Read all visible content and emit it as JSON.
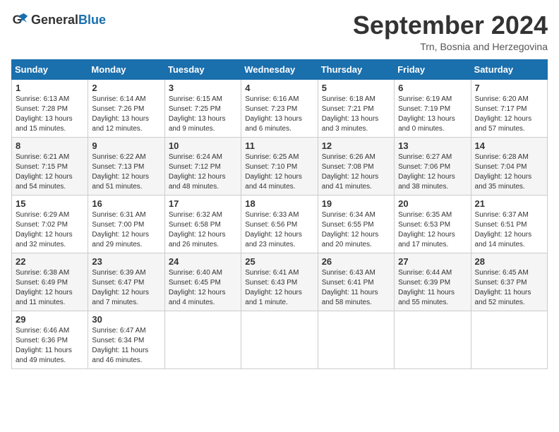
{
  "header": {
    "logo_general": "General",
    "logo_blue": "Blue",
    "month_title": "September 2024",
    "location": "Trn, Bosnia and Herzegovina"
  },
  "days_of_week": [
    "Sunday",
    "Monday",
    "Tuesday",
    "Wednesday",
    "Thursday",
    "Friday",
    "Saturday"
  ],
  "weeks": [
    [
      {
        "day": "1",
        "sunrise": "Sunrise: 6:13 AM",
        "sunset": "Sunset: 7:28 PM",
        "daylight": "Daylight: 13 hours and 15 minutes."
      },
      {
        "day": "2",
        "sunrise": "Sunrise: 6:14 AM",
        "sunset": "Sunset: 7:26 PM",
        "daylight": "Daylight: 13 hours and 12 minutes."
      },
      {
        "day": "3",
        "sunrise": "Sunrise: 6:15 AM",
        "sunset": "Sunset: 7:25 PM",
        "daylight": "Daylight: 13 hours and 9 minutes."
      },
      {
        "day": "4",
        "sunrise": "Sunrise: 6:16 AM",
        "sunset": "Sunset: 7:23 PM",
        "daylight": "Daylight: 13 hours and 6 minutes."
      },
      {
        "day": "5",
        "sunrise": "Sunrise: 6:18 AM",
        "sunset": "Sunset: 7:21 PM",
        "daylight": "Daylight: 13 hours and 3 minutes."
      },
      {
        "day": "6",
        "sunrise": "Sunrise: 6:19 AM",
        "sunset": "Sunset: 7:19 PM",
        "daylight": "Daylight: 13 hours and 0 minutes."
      },
      {
        "day": "7",
        "sunrise": "Sunrise: 6:20 AM",
        "sunset": "Sunset: 7:17 PM",
        "daylight": "Daylight: 12 hours and 57 minutes."
      }
    ],
    [
      {
        "day": "8",
        "sunrise": "Sunrise: 6:21 AM",
        "sunset": "Sunset: 7:15 PM",
        "daylight": "Daylight: 12 hours and 54 minutes."
      },
      {
        "day": "9",
        "sunrise": "Sunrise: 6:22 AM",
        "sunset": "Sunset: 7:13 PM",
        "daylight": "Daylight: 12 hours and 51 minutes."
      },
      {
        "day": "10",
        "sunrise": "Sunrise: 6:24 AM",
        "sunset": "Sunset: 7:12 PM",
        "daylight": "Daylight: 12 hours and 48 minutes."
      },
      {
        "day": "11",
        "sunrise": "Sunrise: 6:25 AM",
        "sunset": "Sunset: 7:10 PM",
        "daylight": "Daylight: 12 hours and 44 minutes."
      },
      {
        "day": "12",
        "sunrise": "Sunrise: 6:26 AM",
        "sunset": "Sunset: 7:08 PM",
        "daylight": "Daylight: 12 hours and 41 minutes."
      },
      {
        "day": "13",
        "sunrise": "Sunrise: 6:27 AM",
        "sunset": "Sunset: 7:06 PM",
        "daylight": "Daylight: 12 hours and 38 minutes."
      },
      {
        "day": "14",
        "sunrise": "Sunrise: 6:28 AM",
        "sunset": "Sunset: 7:04 PM",
        "daylight": "Daylight: 12 hours and 35 minutes."
      }
    ],
    [
      {
        "day": "15",
        "sunrise": "Sunrise: 6:29 AM",
        "sunset": "Sunset: 7:02 PM",
        "daylight": "Daylight: 12 hours and 32 minutes."
      },
      {
        "day": "16",
        "sunrise": "Sunrise: 6:31 AM",
        "sunset": "Sunset: 7:00 PM",
        "daylight": "Daylight: 12 hours and 29 minutes."
      },
      {
        "day": "17",
        "sunrise": "Sunrise: 6:32 AM",
        "sunset": "Sunset: 6:58 PM",
        "daylight": "Daylight: 12 hours and 26 minutes."
      },
      {
        "day": "18",
        "sunrise": "Sunrise: 6:33 AM",
        "sunset": "Sunset: 6:56 PM",
        "daylight": "Daylight: 12 hours and 23 minutes."
      },
      {
        "day": "19",
        "sunrise": "Sunrise: 6:34 AM",
        "sunset": "Sunset: 6:55 PM",
        "daylight": "Daylight: 12 hours and 20 minutes."
      },
      {
        "day": "20",
        "sunrise": "Sunrise: 6:35 AM",
        "sunset": "Sunset: 6:53 PM",
        "daylight": "Daylight: 12 hours and 17 minutes."
      },
      {
        "day": "21",
        "sunrise": "Sunrise: 6:37 AM",
        "sunset": "Sunset: 6:51 PM",
        "daylight": "Daylight: 12 hours and 14 minutes."
      }
    ],
    [
      {
        "day": "22",
        "sunrise": "Sunrise: 6:38 AM",
        "sunset": "Sunset: 6:49 PM",
        "daylight": "Daylight: 12 hours and 11 minutes."
      },
      {
        "day": "23",
        "sunrise": "Sunrise: 6:39 AM",
        "sunset": "Sunset: 6:47 PM",
        "daylight": "Daylight: 12 hours and 7 minutes."
      },
      {
        "day": "24",
        "sunrise": "Sunrise: 6:40 AM",
        "sunset": "Sunset: 6:45 PM",
        "daylight": "Daylight: 12 hours and 4 minutes."
      },
      {
        "day": "25",
        "sunrise": "Sunrise: 6:41 AM",
        "sunset": "Sunset: 6:43 PM",
        "daylight": "Daylight: 12 hours and 1 minute."
      },
      {
        "day": "26",
        "sunrise": "Sunrise: 6:43 AM",
        "sunset": "Sunset: 6:41 PM",
        "daylight": "Daylight: 11 hours and 58 minutes."
      },
      {
        "day": "27",
        "sunrise": "Sunrise: 6:44 AM",
        "sunset": "Sunset: 6:39 PM",
        "daylight": "Daylight: 11 hours and 55 minutes."
      },
      {
        "day": "28",
        "sunrise": "Sunrise: 6:45 AM",
        "sunset": "Sunset: 6:37 PM",
        "daylight": "Daylight: 11 hours and 52 minutes."
      }
    ],
    [
      {
        "day": "29",
        "sunrise": "Sunrise: 6:46 AM",
        "sunset": "Sunset: 6:36 PM",
        "daylight": "Daylight: 11 hours and 49 minutes."
      },
      {
        "day": "30",
        "sunrise": "Sunrise: 6:47 AM",
        "sunset": "Sunset: 6:34 PM",
        "daylight": "Daylight: 11 hours and 46 minutes."
      },
      null,
      null,
      null,
      null,
      null
    ]
  ]
}
